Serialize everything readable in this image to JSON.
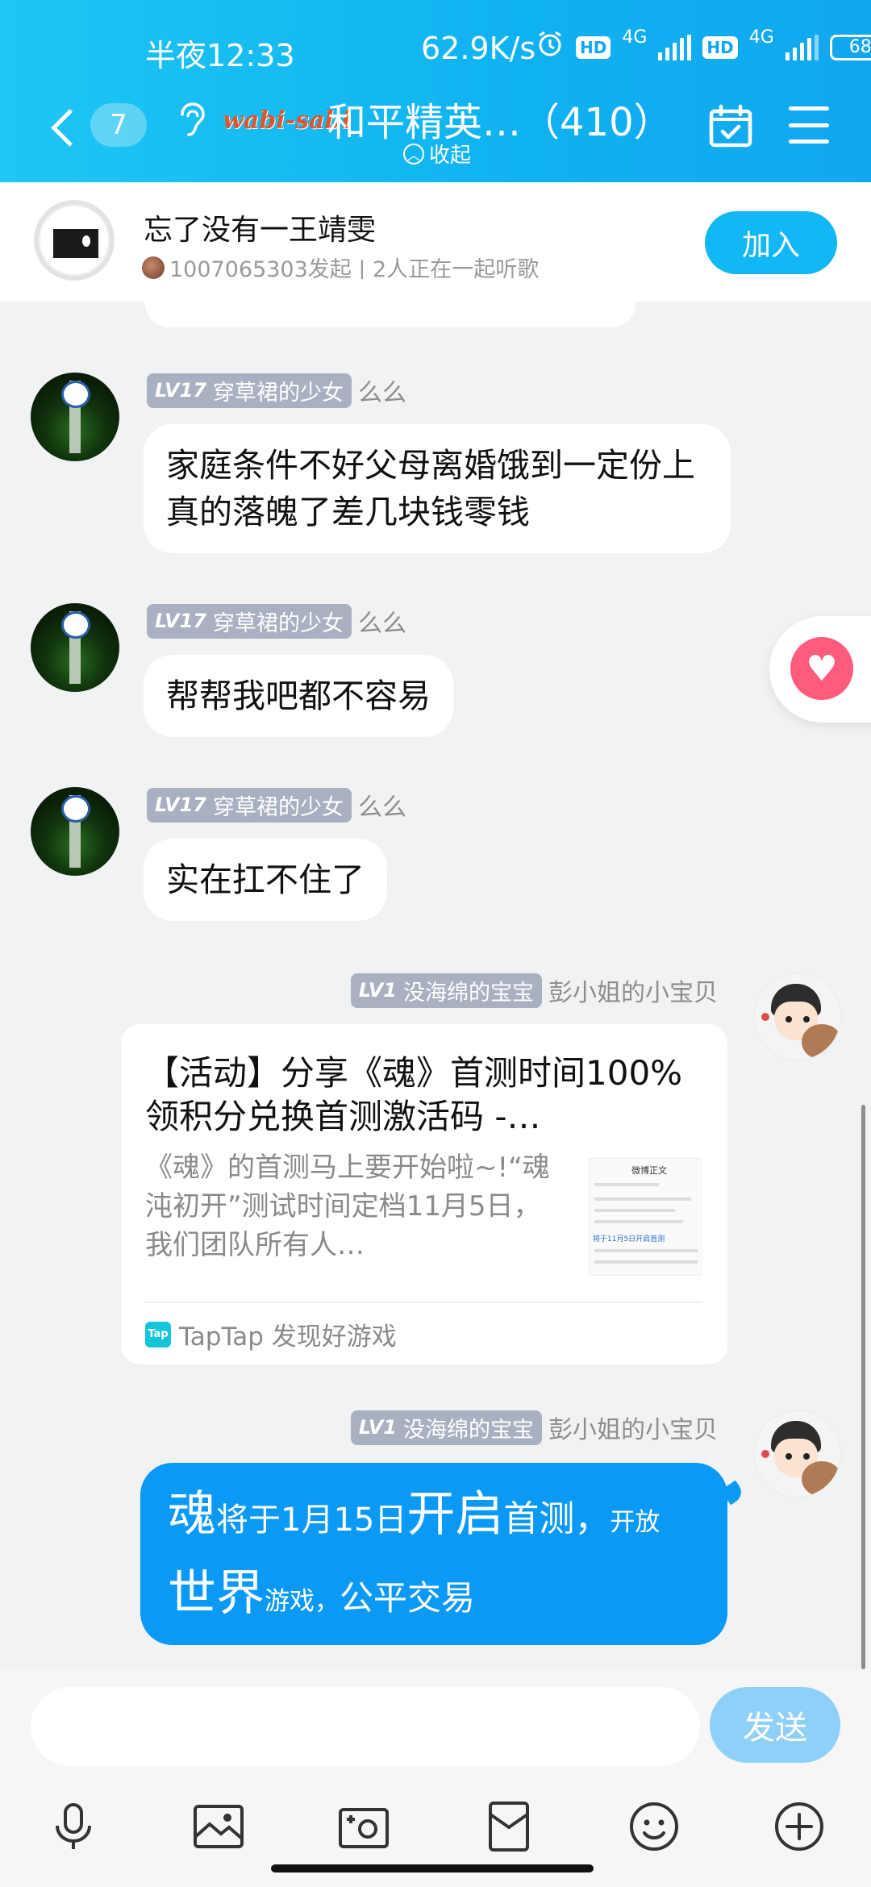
{
  "status_bar": {
    "time": "半夜12:33",
    "speed": "62.9K/s",
    "sim1": "4G",
    "sim2": "4G",
    "battery": "68"
  },
  "header": {
    "unread_count": "7",
    "logo_text": "wabi-sabi",
    "title": "和平精英…（410）",
    "collapse_label": "收起",
    "accent": "#11a7ef"
  },
  "music": {
    "song_title": "忘了没有一王靖雯",
    "subtitle": "1007065303发起 | 2人正在一起听歌",
    "join_label": "加入"
  },
  "messages": [
    {
      "level": "LV17",
      "title_tag": "穿草裙的少女",
      "nickname": "么么",
      "text": "家庭条件不好父母离婚饿到一定份上真的落魄了差几块钱零钱"
    },
    {
      "level": "LV17",
      "title_tag": "穿草裙的少女",
      "nickname": "么么",
      "text": "帮帮我吧都不容易"
    },
    {
      "level": "LV17",
      "title_tag": "穿草裙的少女",
      "nickname": "么么",
      "text": "实在扛不住了"
    },
    {
      "level": "LV1",
      "title_tag": "没海绵的宝宝",
      "nickname": "彭小姐的小宝贝"
    },
    {
      "level": "LV1",
      "title_tag": "没海绵的宝宝",
      "nickname": "彭小姐的小宝贝",
      "parts": [
        "魂",
        "将于1月15日",
        "开启",
        "首测，",
        "开放",
        "世界",
        "游戏，",
        "公平交易"
      ]
    }
  ],
  "card": {
    "title": "【活动】分享《魂》首测时间100%领积分兑换首测激活码 -…",
    "description": "《魂》的首测马上要开始啦~!“魂沌初开”测试时间定档11月5日，我们团队所有人…",
    "thumb_heading": "微博正文",
    "thumb_link": "将于11月5日开启首测",
    "source_icon": "Tap",
    "source": "TapTap 发现好游戏"
  },
  "input": {
    "placeholder": "",
    "send_label": "发送"
  },
  "toolbar_icons": [
    "microphone-icon",
    "image-icon",
    "camera-icon",
    "red-packet-icon",
    "emoji-icon",
    "plus-icon"
  ]
}
